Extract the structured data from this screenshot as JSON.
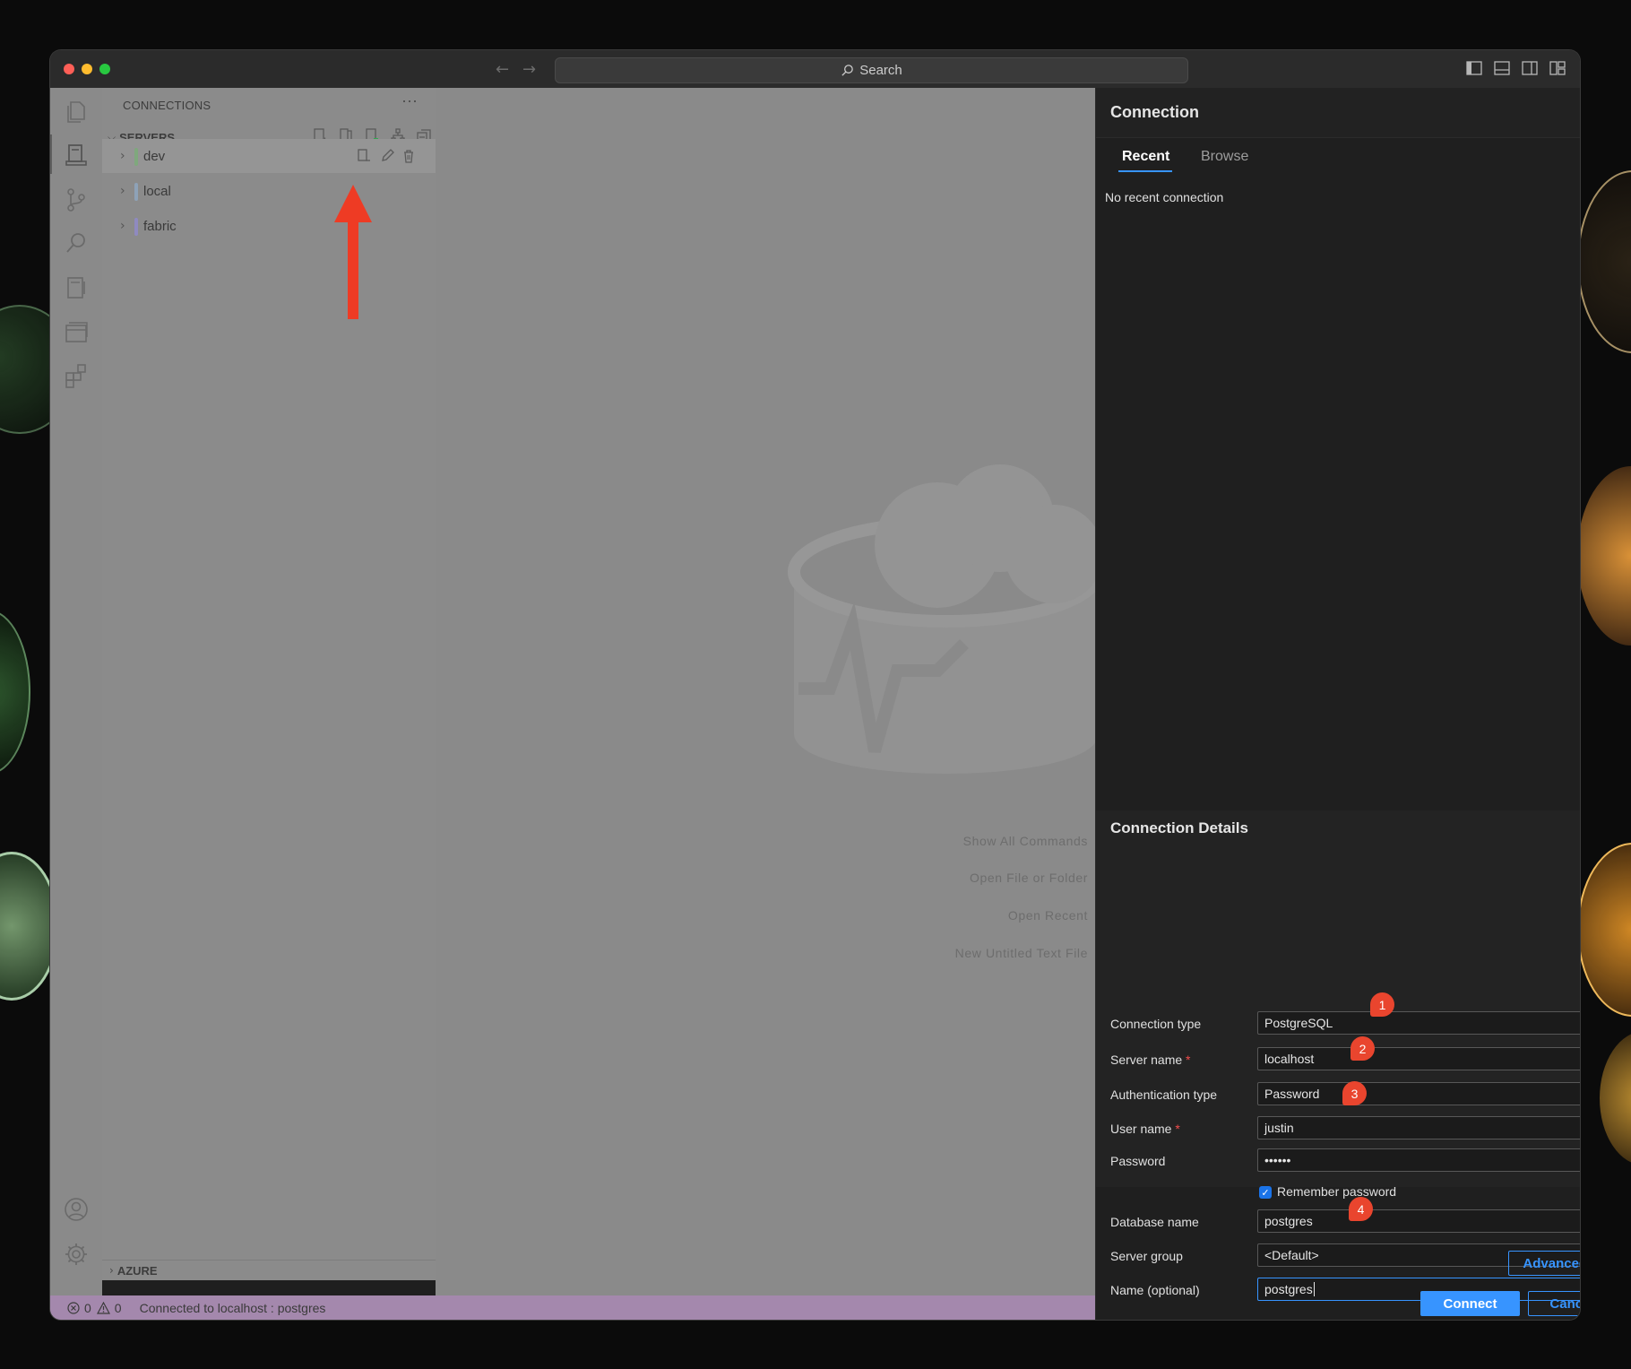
{
  "window": {
    "search_placeholder": "Search"
  },
  "sidebar": {
    "title": "CONNECTIONS",
    "more": "···",
    "servers_label": "SERVERS",
    "servers": [
      {
        "label": "dev",
        "color": "#7fa87d"
      },
      {
        "label": "local",
        "color": "#8ea2b8"
      },
      {
        "label": "fabric",
        "color": "#8f8ac0"
      }
    ],
    "azure_label": "AZURE"
  },
  "editor": {
    "hints": [
      "Show All Commands",
      "Open File or Folder",
      "Open Recent",
      "New Untitled Text File"
    ]
  },
  "status": {
    "errors": "0",
    "warnings": "0",
    "message": "Connected to localhost : postgres"
  },
  "connection_panel": {
    "title": "Connection",
    "tabs": [
      "Recent",
      "Browse"
    ],
    "no_recent": "No recent connection",
    "details_title": "Connection Details",
    "fields": {
      "connection_type": {
        "label": "Connection type",
        "value": "PostgreSQL"
      },
      "server_name": {
        "label": "Server name",
        "value": "localhost",
        "required": "*"
      },
      "auth_type": {
        "label": "Authentication type",
        "value": "Password"
      },
      "user_name": {
        "label": "User name",
        "value": "justin",
        "required": "*"
      },
      "password": {
        "label": "Password",
        "value": "••••••"
      },
      "remember": {
        "label": "Remember password"
      },
      "database": {
        "label": "Database name",
        "value": "postgres"
      },
      "server_group": {
        "label": "Server group",
        "value": "<Default>"
      },
      "name": {
        "label": "Name (optional)",
        "value": "postgres"
      }
    },
    "badges": [
      "1",
      "2",
      "3",
      "4"
    ],
    "advanced_label": "Advanced...",
    "connect_label": "Connect",
    "cancel_label": "Cancel"
  },
  "colors": {
    "accent": "#3794ff",
    "badge": "#e9452e",
    "statusbar": "#a488ad",
    "annotation_arrow": "#ee3b24"
  }
}
